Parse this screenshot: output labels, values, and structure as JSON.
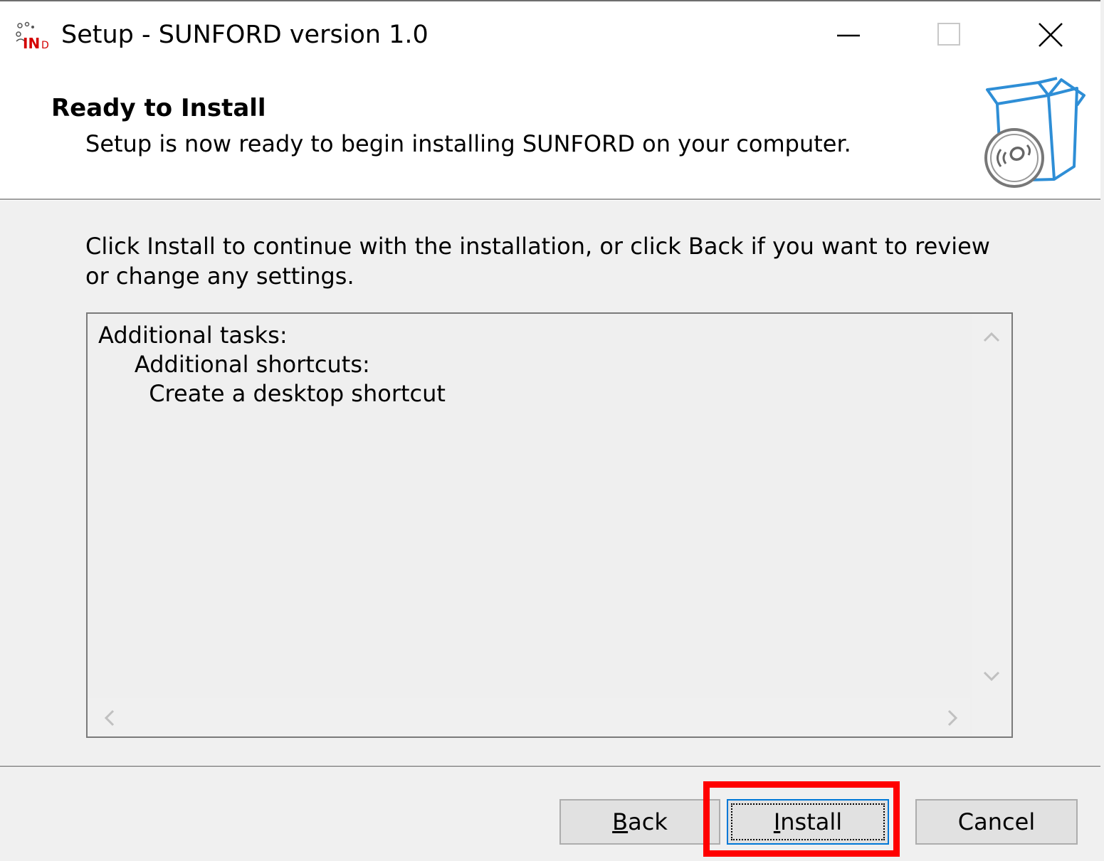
{
  "window": {
    "title": "Setup - SUNFORD version 1.0",
    "app_icon": "installer-app-icon",
    "controls": [
      "minimize-icon",
      "maximize-icon",
      "close-icon"
    ]
  },
  "header": {
    "title": "Ready to Install",
    "subtitle": "Setup is now ready to begin installing SUNFORD on your computer.",
    "graphic": "setup-box-disc-icon"
  },
  "body": {
    "instruction": "Click Install to continue with the installation, or click Back if you want to review or change any settings.",
    "memo_lines": [
      "Additional tasks:",
      "     Additional shortcuts:",
      "       Create a desktop shortcut"
    ]
  },
  "buttons": {
    "back": {
      "prefix": "",
      "accel": "B",
      "rest": "ack"
    },
    "install": {
      "prefix": "",
      "accel": "I",
      "rest": "nstall"
    },
    "cancel": "Cancel"
  },
  "colors": {
    "focus_border": "#0078d7",
    "annotation_highlight": "#ff0000",
    "dialog_background": "#f0f0f0",
    "header_background": "#ffffff"
  }
}
